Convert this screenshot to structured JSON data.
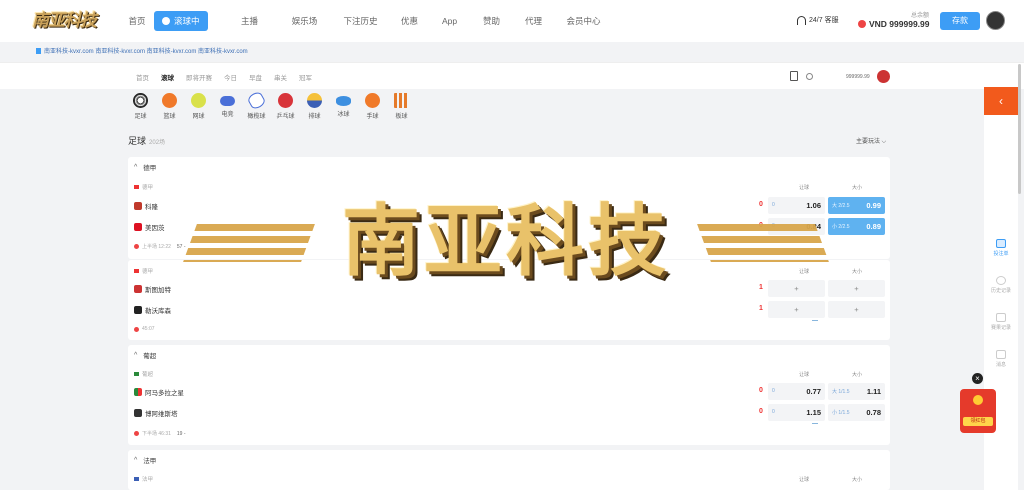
{
  "logo": {
    "text": "南亚科技"
  },
  "nav": {
    "items": [
      "首页",
      "滚球中",
      "主播",
      "娱乐场",
      "下注历史",
      "优惠",
      "App",
      "赞助",
      "代理",
      "会员中心"
    ],
    "support": "24/7 客服",
    "balance_label": "总余额",
    "balance": "VND 999999.99",
    "deposit": "存款"
  },
  "notice": "南亚科技-kvxr.com 南亚科技-kvxr.com 南亚科技-kvxr.com 南亚科技-kvxr.com",
  "subnav": {
    "items": [
      "首页",
      "滚球",
      "即将开赛",
      "今日",
      "早盘",
      "串关",
      "冠军"
    ],
    "balance": "999999.99"
  },
  "sports": [
    "足球",
    "篮球",
    "网球",
    "电竞",
    "橄榄球",
    "乒乓球",
    "排球",
    "冰球",
    "手球",
    "板球"
  ],
  "section": {
    "title": "足球",
    "count": "202场",
    "play_select": "主要玩法 ⌵"
  },
  "cards": [
    {
      "league": "德甲",
      "sub_league": "德甲",
      "col_hcp": "让球",
      "col_ou": "大小",
      "home": {
        "name": "科隆",
        "score": "0",
        "hcp_pre": "0",
        "hcp": "1.06",
        "ou_pre": "大 2/2.5",
        "ou": "0.99"
      },
      "away": {
        "name": "美因茨",
        "score": "0",
        "hcp_pre": "0",
        "hcp": "0.84",
        "ou_pre": "小 2/2.5",
        "ou": "0.89"
      },
      "foot": "上半场 12:22",
      "foot_extra": "57 -"
    },
    {
      "sub_league": "德甲",
      "col_hcp": "让球",
      "col_ou": "大小",
      "home": {
        "name": "斯图加特",
        "score": "1",
        "hcp": "+",
        "ou": "+"
      },
      "away": {
        "name": "勒沃库森",
        "score": "1",
        "hcp": "+",
        "ou": "+"
      },
      "foot": "45:07"
    },
    {
      "league": "葡超",
      "sub_league": "葡超",
      "col_hcp": "让球",
      "col_ou": "大小",
      "home": {
        "name": "阿马多拉之星",
        "score": "0",
        "hcp_pre": "0",
        "hcp": "0.77",
        "ou_pre": "大 1/1.5",
        "ou": "1.11"
      },
      "away": {
        "name": "博阿维斯塔",
        "score": "0",
        "hcp_pre": "0",
        "hcp": "1.15",
        "ou_pre": "小 1/1.5",
        "ou": "0.78"
      },
      "foot": "下半场 46:31",
      "foot_extra": "19 -"
    },
    {
      "league": "法甲",
      "sub_league": "法甲",
      "col_hcp": "让球",
      "col_ou": "大小"
    }
  ],
  "sidebar": {
    "items": [
      "投注单",
      "历史记录",
      "赛果记录",
      "消息"
    ]
  },
  "watermark": "南亚科技",
  "redpack": {
    "label": "领红包"
  },
  "colors": {
    "accent": "#3d9df5",
    "orange": "#f25a1c",
    "score": "#e33"
  }
}
